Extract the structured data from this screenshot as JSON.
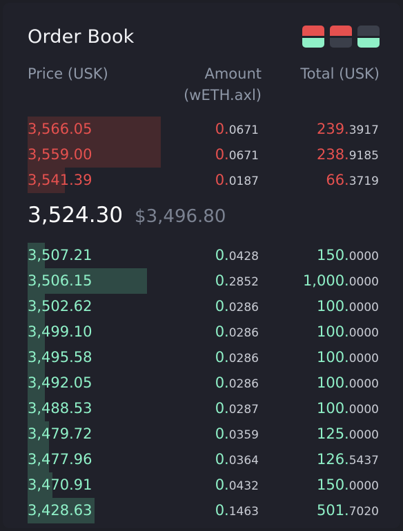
{
  "order_book": {
    "title": "Order Book",
    "view_buttons": [
      {
        "name": "view-both",
        "top": "#e5514f",
        "bottom": "#8ff0c7"
      },
      {
        "name": "view-asks",
        "top": "#e5514f",
        "bottom": "#3b3f4a"
      },
      {
        "name": "view-bids",
        "top": "#3b3f4a",
        "bottom": "#8ff0c7"
      }
    ],
    "columns": {
      "price": "Price (USK)",
      "amount_line1": "Amount",
      "amount_line2": "(wETH.axl)",
      "total": "Total (USK)"
    },
    "asks": [
      {
        "price": "3,566.05",
        "amount_int": "0.",
        "amount_dec": "0671",
        "total_int": "239.",
        "total_dec": "3917",
        "depth": 0.38
      },
      {
        "price": "3,559.00",
        "amount_int": "0.",
        "amount_dec": "0671",
        "total_int": "238.",
        "total_dec": "9185",
        "depth": 0.38
      },
      {
        "price": "3,541.39",
        "amount_int": "0.",
        "amount_dec": "0187",
        "total_int": "66.",
        "total_dec": "3719",
        "depth": 0.106
      }
    ],
    "mid": {
      "last_price": "3,524.30",
      "usd_price": "$3,496.80"
    },
    "bids": [
      {
        "price": "3,507.21",
        "amount_int": "0.",
        "amount_dec": "0428",
        "total_int": "150.",
        "total_dec": "0000",
        "depth": 0.05
      },
      {
        "price": "3,506.15",
        "amount_int": "0.",
        "amount_dec": "2852",
        "total_int": "1,000.",
        "total_dec": "0000",
        "depth": 0.34
      },
      {
        "price": "3,502.62",
        "amount_int": "0.",
        "amount_dec": "0286",
        "total_int": "100.",
        "total_dec": "0000",
        "depth": 0.05
      },
      {
        "price": "3,499.10",
        "amount_int": "0.",
        "amount_dec": "0286",
        "total_int": "100.",
        "total_dec": "0000",
        "depth": 0.05
      },
      {
        "price": "3,495.58",
        "amount_int": "0.",
        "amount_dec": "0286",
        "total_int": "100.",
        "total_dec": "0000",
        "depth": 0.05
      },
      {
        "price": "3,492.05",
        "amount_int": "0.",
        "amount_dec": "0286",
        "total_int": "100.",
        "total_dec": "0000",
        "depth": 0.05
      },
      {
        "price": "3,488.53",
        "amount_int": "0.",
        "amount_dec": "0287",
        "total_int": "100.",
        "total_dec": "0000",
        "depth": 0.05
      },
      {
        "price": "3,479.72",
        "amount_int": "0.",
        "amount_dec": "0359",
        "total_int": "125.",
        "total_dec": "0000",
        "depth": 0.06
      },
      {
        "price": "3,477.96",
        "amount_int": "0.",
        "amount_dec": "0364",
        "total_int": "126.",
        "total_dec": "5437",
        "depth": 0.06
      },
      {
        "price": "3,470.91",
        "amount_int": "0.",
        "amount_dec": "0432",
        "total_int": "150.",
        "total_dec": "0000",
        "depth": 0.07
      },
      {
        "price": "3,428.63",
        "amount_int": "0.",
        "amount_dec": "1463",
        "total_int": "501.",
        "total_dec": "7020",
        "depth": 0.19
      }
    ]
  }
}
